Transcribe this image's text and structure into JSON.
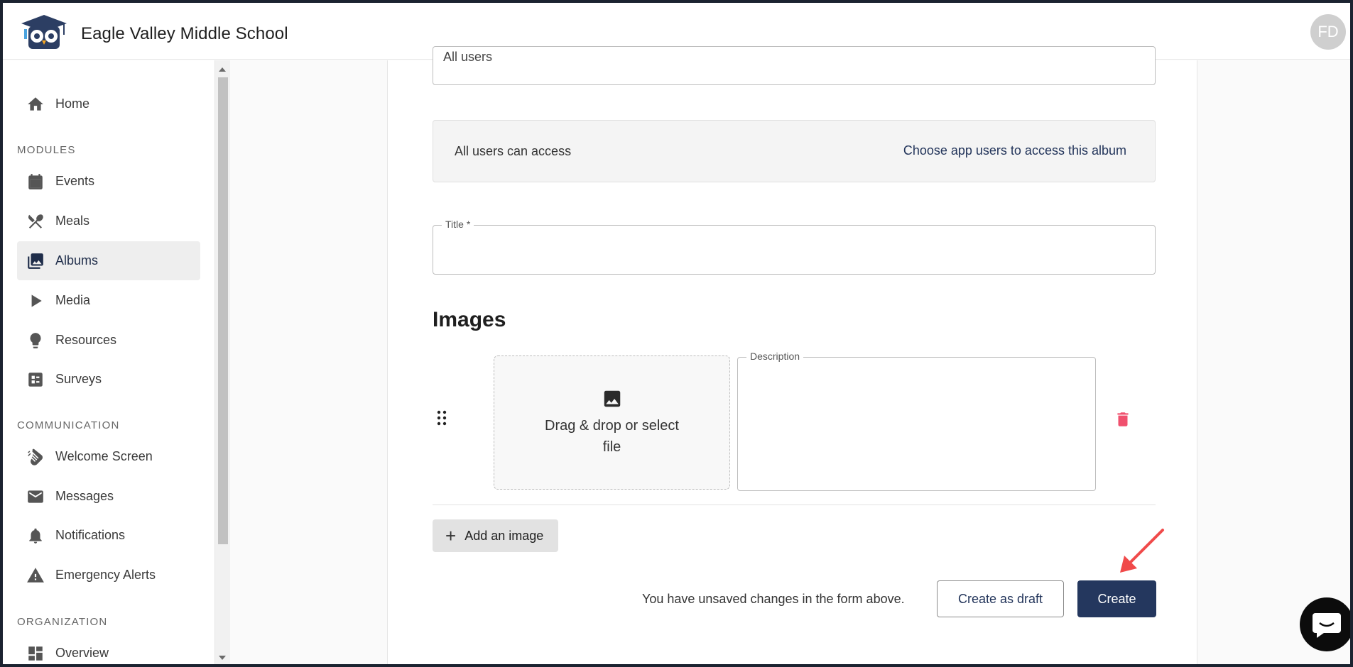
{
  "header": {
    "school_name": "Eagle Valley Middle School",
    "avatar_initials": "FD"
  },
  "sidebar": {
    "home": "Home",
    "sections": {
      "modules": "MODULES",
      "communication": "COMMUNICATION",
      "organization": "ORGANIZATION"
    },
    "modules": [
      {
        "label": "Events",
        "icon": "calendar-icon"
      },
      {
        "label": "Meals",
        "icon": "utensils-icon"
      },
      {
        "label": "Albums",
        "icon": "photo-library-icon",
        "active": true
      },
      {
        "label": "Media",
        "icon": "play-icon"
      },
      {
        "label": "Resources",
        "icon": "lightbulb-icon"
      },
      {
        "label": "Surveys",
        "icon": "survey-icon"
      }
    ],
    "communication": [
      {
        "label": "Welcome Screen",
        "icon": "waving-hand-icon"
      },
      {
        "label": "Messages",
        "icon": "mail-icon"
      },
      {
        "label": "Notifications",
        "icon": "bell-icon"
      },
      {
        "label": "Emergency Alerts",
        "icon": "warning-icon"
      }
    ],
    "organization": [
      {
        "label": "Overview",
        "icon": "dashboard-icon"
      }
    ]
  },
  "form": {
    "top_field_value": "All users",
    "access_text": "All users can access",
    "access_link": "Choose app users to access this album",
    "title_label": "Title *",
    "title_value": "",
    "images_heading": "Images",
    "dropzone_text": "Drag & drop or select file",
    "description_label": "Description",
    "add_image_label": "Add an image",
    "unsaved_text": "You have unsaved changes in the form above.",
    "create_draft_label": "Create as draft",
    "create_label": "Create"
  },
  "colors": {
    "accent": "#24375e",
    "delete": "#f0506e",
    "annotation_arrow": "#f04a4a"
  }
}
